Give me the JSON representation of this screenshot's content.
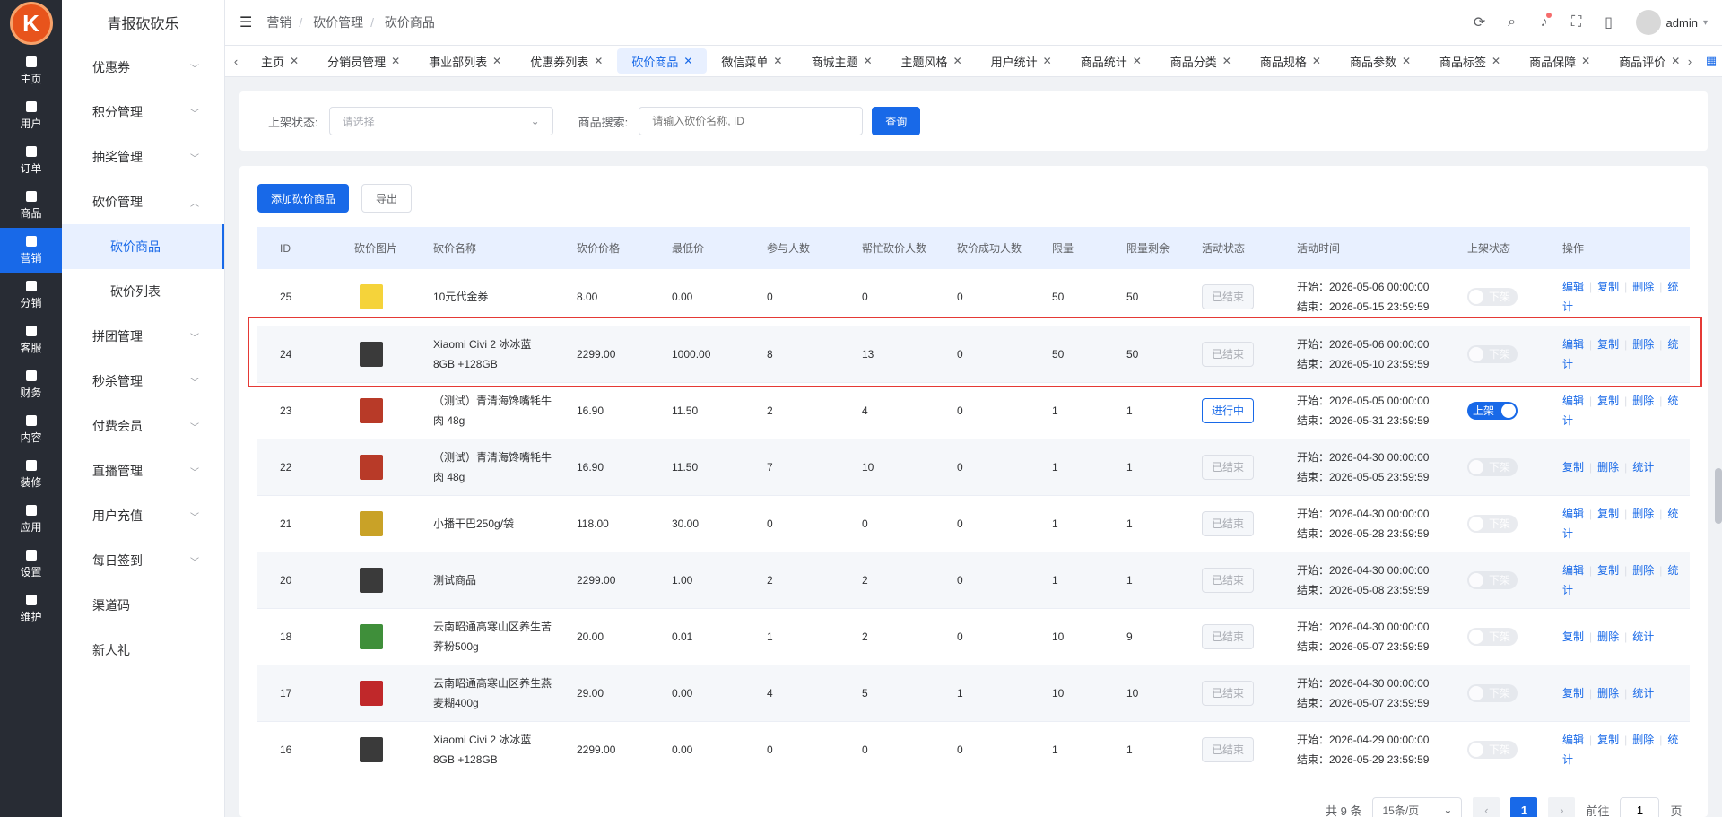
{
  "brand": {
    "logo_letter": "K",
    "name": "青报砍砍乐"
  },
  "iconnav": [
    {
      "label": "主页",
      "icon": "home-icon"
    },
    {
      "label": "用户",
      "icon": "user-icon"
    },
    {
      "label": "订单",
      "icon": "order-icon"
    },
    {
      "label": "商品",
      "icon": "goods-icon"
    },
    {
      "label": "营销",
      "icon": "marketing-icon",
      "active": true
    },
    {
      "label": "分销",
      "icon": "distribution-icon"
    },
    {
      "label": "客服",
      "icon": "service-icon"
    },
    {
      "label": "财务",
      "icon": "finance-icon"
    },
    {
      "label": "内容",
      "icon": "content-icon"
    },
    {
      "label": "装修",
      "icon": "decorate-icon"
    },
    {
      "label": "应用",
      "icon": "apps-icon"
    },
    {
      "label": "设置",
      "icon": "settings-icon"
    },
    {
      "label": "维护",
      "icon": "maintenance-icon"
    }
  ],
  "submenu": [
    {
      "label": "优惠券",
      "chevron": "down"
    },
    {
      "label": "积分管理",
      "chevron": "down"
    },
    {
      "label": "抽奖管理",
      "chevron": "down"
    },
    {
      "label": "砍价管理",
      "chevron": "up"
    },
    {
      "label": "砍价商品",
      "sub": true,
      "active": true
    },
    {
      "label": "砍价列表",
      "sub": true
    },
    {
      "label": "拼团管理",
      "chevron": "down"
    },
    {
      "label": "秒杀管理",
      "chevron": "down"
    },
    {
      "label": "付费会员",
      "chevron": "down"
    },
    {
      "label": "直播管理",
      "chevron": "down"
    },
    {
      "label": "用户充值",
      "chevron": "down"
    },
    {
      "label": "每日签到",
      "chevron": "down"
    },
    {
      "label": "渠道码"
    },
    {
      "label": "新人礼"
    }
  ],
  "breadcrumb": [
    "营销",
    "砍价管理",
    "砍价商品"
  ],
  "header": {
    "username": "admin"
  },
  "tabs": [
    "主页",
    "分销员管理",
    "事业部列表",
    "优惠券列表",
    "砍价商品",
    "微信菜单",
    "商城主题",
    "主题风格",
    "用户统计",
    "商品统计",
    "商品分类",
    "商品规格",
    "商品参数",
    "商品标签",
    "商品保障",
    "商品评价"
  ],
  "active_tab": 4,
  "filter": {
    "status_label": "上架状态:",
    "status_placeholder": "请选择",
    "search_label": "商品搜索:",
    "search_placeholder": "请输入砍价名称, ID",
    "query_button": "查询"
  },
  "actions": {
    "add": "添加砍价商品",
    "export": "导出"
  },
  "columns": [
    "ID",
    "砍价图片",
    "砍价名称",
    "砍价价格",
    "最低价",
    "参与人数",
    "帮忙砍价人数",
    "砍价成功人数",
    "限量",
    "限量剩余",
    "活动状态",
    "活动时间",
    "上架状态",
    "操作"
  ],
  "rows": [
    {
      "id": "25",
      "img": "#f5d33a",
      "name": "10元代金券",
      "price": "8.00",
      "min": "0.00",
      "join": "0",
      "help": "0",
      "success": "0",
      "limit": "50",
      "left": "50",
      "status": "已结束",
      "start": "开始：2026-05-06 00:00:00",
      "end": "结束：2026-05-15 23:59:59",
      "on": false,
      "sw_off": "下架",
      "ops": [
        "编辑",
        "复制",
        "删除",
        "统计"
      ]
    },
    {
      "id": "24",
      "img": "#3a3a3a",
      "name": "Xiaomi Civi 2 冰冰蓝 8GB +128GB",
      "price": "2299.00",
      "min": "1000.00",
      "join": "8",
      "help": "13",
      "success": "0",
      "limit": "50",
      "left": "50",
      "status": "已结束",
      "start": "开始：2026-05-06 00:00:00",
      "end": "结束：2026-05-10 23:59:59",
      "on": false,
      "sw_off": "下架",
      "ops": [
        "编辑",
        "复制",
        "删除",
        "统计"
      ]
    },
    {
      "id": "23",
      "img": "#b83a28",
      "name": "（测试）青清海馋嘴牦牛肉 48g",
      "price": "16.90",
      "min": "11.50",
      "join": "2",
      "help": "4",
      "success": "0",
      "limit": "1",
      "left": "1",
      "status": "进行中",
      "start": "开始：2026-05-05 00:00:00",
      "end": "结束：2026-05-31 23:59:59",
      "on": true,
      "sw_on": "上架",
      "ops": [
        "编辑",
        "复制",
        "删除",
        "统计"
      ]
    },
    {
      "id": "22",
      "img": "#b83a28",
      "name": "（测试）青清海馋嘴牦牛肉 48g",
      "price": "16.90",
      "min": "11.50",
      "join": "7",
      "help": "10",
      "success": "0",
      "limit": "1",
      "left": "1",
      "status": "已结束",
      "start": "开始：2026-04-30 00:00:00",
      "end": "结束：2026-05-05 23:59:59",
      "on": false,
      "sw_off": "下架",
      "ops": [
        "复制",
        "删除",
        "统计"
      ]
    },
    {
      "id": "21",
      "img": "#c9a227",
      "name": "小播干巴250g/袋",
      "price": "118.00",
      "min": "30.00",
      "join": "0",
      "help": "0",
      "success": "0",
      "limit": "1",
      "left": "1",
      "status": "已结束",
      "start": "开始：2026-04-30 00:00:00",
      "end": "结束：2026-05-28 23:59:59",
      "on": false,
      "sw_off": "下架",
      "ops": [
        "编辑",
        "复制",
        "删除",
        "统计"
      ]
    },
    {
      "id": "20",
      "img": "#3a3a3a",
      "name": "测试商品",
      "price": "2299.00",
      "min": "1.00",
      "join": "2",
      "help": "2",
      "success": "0",
      "limit": "1",
      "left": "1",
      "status": "已结束",
      "start": "开始：2026-04-30 00:00:00",
      "end": "结束：2026-05-08 23:59:59",
      "on": false,
      "sw_off": "下架",
      "ops": [
        "编辑",
        "复制",
        "删除",
        "统计"
      ]
    },
    {
      "id": "18",
      "img": "#3f8f3a",
      "name": "云南昭通高寒山区养生苦荞粉500g",
      "price": "20.00",
      "min": "0.01",
      "join": "1",
      "help": "2",
      "success": "0",
      "limit": "10",
      "left": "9",
      "status": "已结束",
      "start": "开始：2026-04-30 00:00:00",
      "end": "结束：2026-05-07 23:59:59",
      "on": false,
      "sw_off": "下架",
      "ops": [
        "复制",
        "删除",
        "统计"
      ]
    },
    {
      "id": "17",
      "img": "#c0282a",
      "name": "云南昭通高寒山区养生燕麦糊400g",
      "price": "29.00",
      "min": "0.00",
      "join": "4",
      "help": "5",
      "success": "1",
      "limit": "10",
      "left": "10",
      "status": "已结束",
      "start": "开始：2026-04-30 00:00:00",
      "end": "结束：2026-05-07 23:59:59",
      "on": false,
      "sw_off": "下架",
      "ops": [
        "复制",
        "删除",
        "统计"
      ]
    },
    {
      "id": "16",
      "img": "#3a3a3a",
      "name": "Xiaomi Civi 2 冰冰蓝 8GB +128GB",
      "price": "2299.00",
      "min": "0.00",
      "join": "0",
      "help": "0",
      "success": "0",
      "limit": "1",
      "left": "1",
      "status": "已结束",
      "start": "开始：2026-04-29 00:00:00",
      "end": "结束：2026-05-29 23:59:59",
      "on": false,
      "sw_off": "下架",
      "ops": [
        "编辑",
        "复制",
        "删除",
        "统计"
      ]
    }
  ],
  "pager": {
    "total": "共 9 条",
    "size": "15条/页",
    "current": "1",
    "goto": "前往",
    "goto_value": "1",
    "page": "页"
  }
}
